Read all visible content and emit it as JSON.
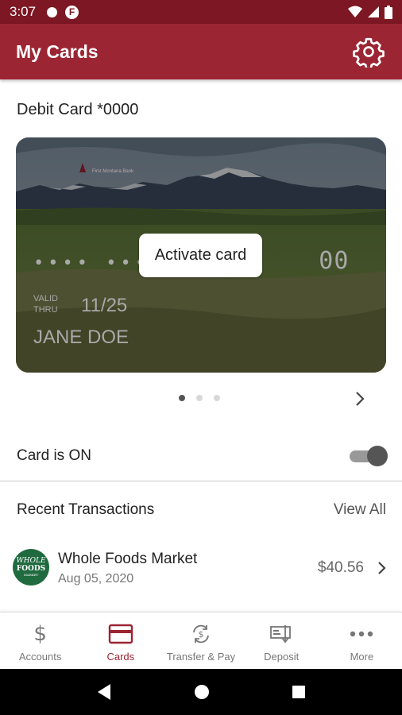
{
  "status_bar": {
    "time": "3:07",
    "notification_glyph": "F"
  },
  "header": {
    "title": "My Cards",
    "settings_icon": "gear-icon"
  },
  "card": {
    "title": "Debit Card *0000",
    "bank_name": "First Montana Bank",
    "number_masked_dots": "•••• ••••",
    "number_last": "00",
    "valid_label": "VALID THRU",
    "expiry": "11/25",
    "holder": "JANE DOE",
    "activate_label": "Activate card",
    "pager": {
      "total": 3,
      "active_index": 0
    }
  },
  "card_toggle": {
    "label": "Card is ON",
    "is_on": true
  },
  "transactions": {
    "heading": "Recent Transactions",
    "view_all": "View All",
    "items": [
      {
        "merchant": "Whole Foods Market",
        "date": "Aug 05, 2020",
        "amount": "$40.56",
        "logo_line1": "WHOLE",
        "logo_line2": "FOODS",
        "logo_line3": "MARKET"
      }
    ]
  },
  "bottom_nav": {
    "items": [
      {
        "label": "Accounts",
        "icon": "dollar-icon",
        "active": false
      },
      {
        "label": "Cards",
        "icon": "card-icon",
        "active": true
      },
      {
        "label": "Transfer & Pay",
        "icon": "transfer-icon",
        "active": false
      },
      {
        "label": "Deposit",
        "icon": "deposit-check-icon",
        "active": false
      },
      {
        "label": "More",
        "icon": "more-dots-icon",
        "active": false
      }
    ]
  },
  "colors": {
    "brand": "#9c2533",
    "status_bar": "#7d1723",
    "active_nav": "#9c2533"
  }
}
